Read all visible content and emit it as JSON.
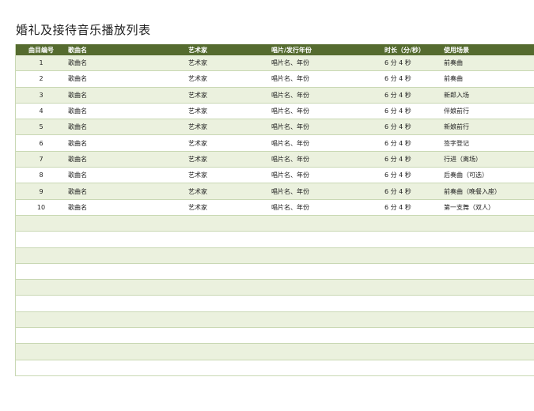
{
  "title": "婚礼及接待音乐播放列表",
  "headers": {
    "num": "曲目编号",
    "song": "歌曲名",
    "artist": "艺术家",
    "album": "唱片/发行年份",
    "time": "时长（分/秒）",
    "use": "使用场景"
  },
  "rows": [
    {
      "num": "1",
      "song": "歌曲名",
      "artist": "艺术家",
      "album": "唱片名、年份",
      "time": "6 分 4 秒",
      "use": "前奏曲"
    },
    {
      "num": "2",
      "song": "歌曲名",
      "artist": "艺术家",
      "album": "唱片名、年份",
      "time": "6 分 4 秒",
      "use": "前奏曲"
    },
    {
      "num": "3",
      "song": "歌曲名",
      "artist": "艺术家",
      "album": "唱片名、年份",
      "time": "6 分 4 秒",
      "use": "新郎入场"
    },
    {
      "num": "4",
      "song": "歌曲名",
      "artist": "艺术家",
      "album": "唱片名、年份",
      "time": "6 分 4 秒",
      "use": "伴娘前行"
    },
    {
      "num": "5",
      "song": "歌曲名",
      "artist": "艺术家",
      "album": "唱片名、年份",
      "time": "6 分 4 秒",
      "use": "新娘前行"
    },
    {
      "num": "6",
      "song": "歌曲名",
      "artist": "艺术家",
      "album": "唱片名、年份",
      "time": "6 分 4 秒",
      "use": "签字登记"
    },
    {
      "num": "7",
      "song": "歌曲名",
      "artist": "艺术家",
      "album": "唱片名、年份",
      "time": "6 分 4 秒",
      "use": "行进（离场）"
    },
    {
      "num": "8",
      "song": "歌曲名",
      "artist": "艺术家",
      "album": "唱片名、年份",
      "time": "6 分 4 秒",
      "use": "后奏曲（可选）"
    },
    {
      "num": "9",
      "song": "歌曲名",
      "artist": "艺术家",
      "album": "唱片名、年份",
      "time": "6 分 4 秒",
      "use": "前奏曲（晚餐入座）"
    },
    {
      "num": "10",
      "song": "歌曲名",
      "artist": "艺术家",
      "album": "唱片名、年份",
      "time": "6 分 4 秒",
      "use": "第一支舞（双人）"
    }
  ],
  "empty_row_count": 10,
  "colors": {
    "header": "#556b2f",
    "band": "#ebf1de",
    "border": "#c9d8b4"
  }
}
